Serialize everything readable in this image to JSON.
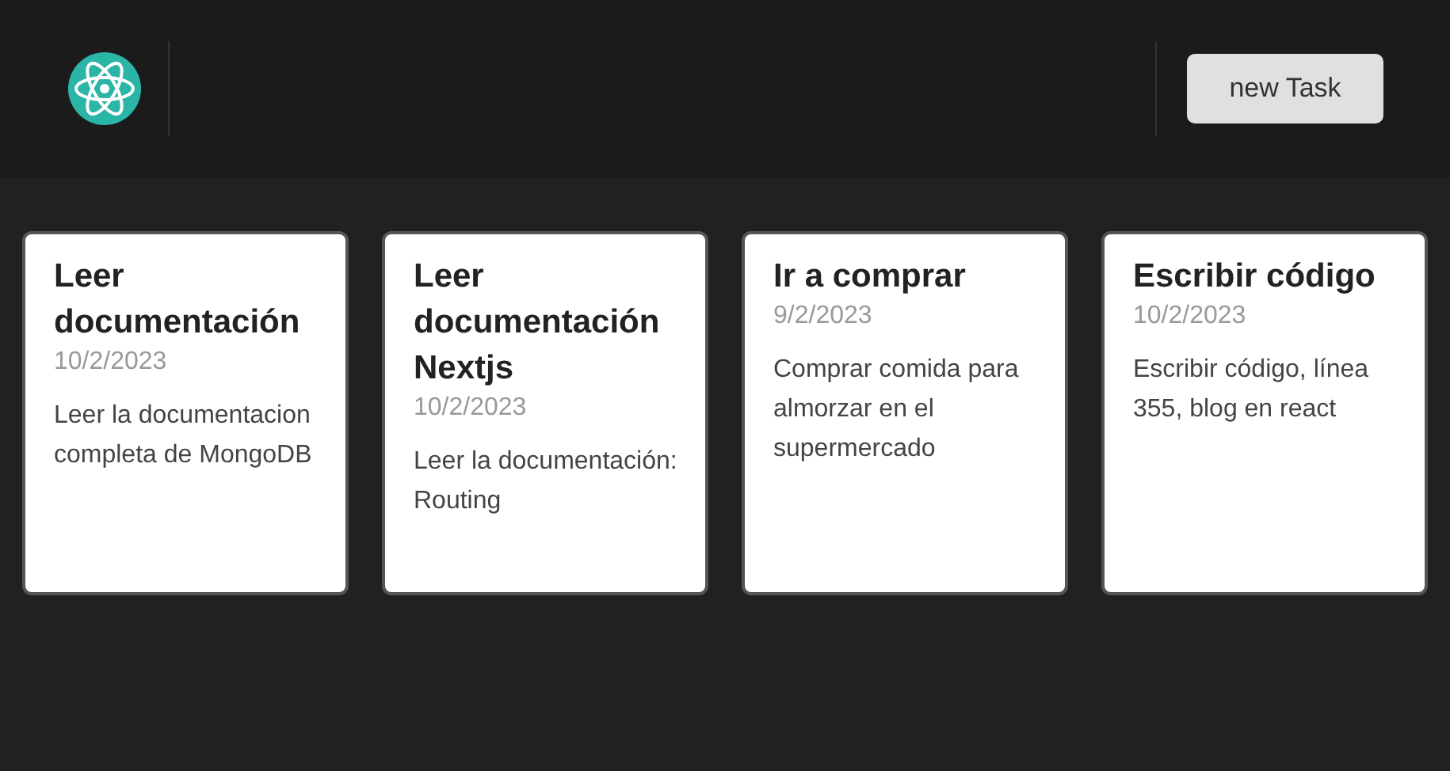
{
  "header": {
    "button": "new Task"
  },
  "tasks": [
    {
      "title": "Leer documentación",
      "date": "10/2/2023",
      "description": "Leer la documentacion completa de MongoDB"
    },
    {
      "title": "Leer documentación Nextjs",
      "date": "10/2/2023",
      "description": "Leer la documentación: Routing"
    },
    {
      "title": "Ir a comprar",
      "date": "9/2/2023",
      "description": "Comprar comida para almorzar en el supermercado"
    },
    {
      "title": "Escribir código",
      "date": "10/2/2023",
      "description": "Escribir código, línea 355, blog en react"
    }
  ]
}
